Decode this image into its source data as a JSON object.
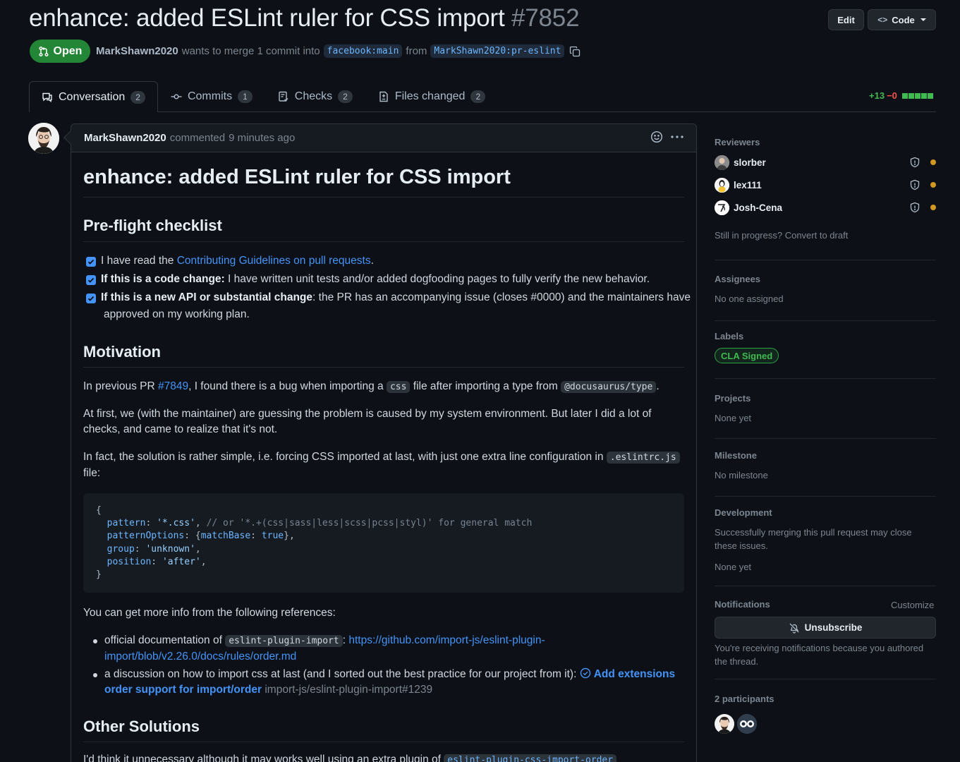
{
  "header": {
    "title": "enhance: added ESLint ruler for CSS import",
    "number": "#7852",
    "edit_label": "Edit",
    "code_label": "Code",
    "state": "Open",
    "author": "MarkShawn2020",
    "merge_text": "wants to merge 1 commit into",
    "base_branch": "facebook:main",
    "from_text": "from",
    "head_branch": "MarkShawn2020:pr-eslint"
  },
  "tabs": [
    {
      "label": "Conversation",
      "count": "2",
      "icon": "comment-icon"
    },
    {
      "label": "Commits",
      "count": "1",
      "icon": "commit-icon"
    },
    {
      "label": "Checks",
      "count": "2",
      "icon": "checklist-icon"
    },
    {
      "label": "Files changed",
      "count": "2",
      "icon": "file-diff-icon"
    }
  ],
  "diffstat": {
    "additions": "+13",
    "deletions": "−0"
  },
  "comment": {
    "author": "MarkShawn2020",
    "action": "commented",
    "time": "9 minutes ago",
    "title": "enhance: added ESLint ruler for CSS import",
    "checklist_heading": "Pre-flight checklist",
    "checklist": [
      {
        "pre": "I have read the ",
        "link": "Contributing Guidelines on pull requests",
        "post": "."
      },
      {
        "bold": "If this is a code change:",
        "text": " I have written unit tests and/or added dogfooding pages to fully verify the new behavior."
      },
      {
        "bold": "If this is a new API or substantial change",
        "text": ": the PR has an accompanying issue (closes #0000) and the maintainers have",
        "text2": "approved on my working plan."
      }
    ],
    "motivation_heading": "Motivation",
    "motivation_p1": {
      "pre": "In previous PR ",
      "link": "#7849",
      "mid": ", I found there is a bug when importing a ",
      "code1": "css",
      "mid2": " file after importing a type from ",
      "code2": "@docusaurus/type",
      "post": "."
    },
    "motivation_p2_line1": "At first, we (with the maintainer) are guessing the problem is caused by my system environment. But later I did a lot of",
    "motivation_p2_line2": "checks, and came to realize that it's not.",
    "motivation_p3": {
      "pre": "In fact, the solution is rather simple, i.e. forcing CSS imported at last, with just one extra line configuration in ",
      "code": ".eslintrc.js",
      "line2": "file:"
    },
    "code_lines": {
      "open": "{",
      "l1_key": "pattern",
      "l1_val": "'*.css'",
      "l1_comment": "// or '*.+(css|sass|less|scss|pcss|styl)' for general match",
      "l2_key": "patternOptions",
      "l2_inner_key": "matchBase",
      "l2_inner_val": "true",
      "l3_key": "group",
      "l3_val": "'unknown'",
      "l4_key": "position",
      "l4_val": "'after'",
      "close": "}"
    },
    "refs_intro": "You can get more info from the following references:",
    "ref1": {
      "pre": "official documentation of ",
      "code": "eslint-plugin-import",
      "mid": ": ",
      "link1": "https://github.com/import-js/eslint-plugin-",
      "link2": "import/blob/v2.26.0/docs/rules/order.md"
    },
    "ref2": {
      "pre": "a discussion on how to import css at last (and I sorted out the best practice for our project from it): ",
      "link1": "Add extensions",
      "link2": "order support for import/order",
      "repo": "import-js/eslint-plugin-import#1239"
    },
    "other_heading": "Other Solutions",
    "other_p": {
      "pre": "I'd think it unnecessary although it may works well using an extra plugin of ",
      "code": "eslint-plugin-css-import-order"
    }
  },
  "sidebar": {
    "reviewers_heading": "Reviewers",
    "reviewers": [
      "slorber",
      "lex111",
      "Josh-Cena"
    ],
    "draft_text": "Still in progress? Convert to draft",
    "assignees_heading": "Assignees",
    "assignees_value": "No one assigned",
    "labels_heading": "Labels",
    "label": "CLA Signed",
    "projects_heading": "Projects",
    "projects_value": "None yet",
    "milestone_heading": "Milestone",
    "milestone_value": "No milestone",
    "development_heading": "Development",
    "development_text1": "Successfully merging this pull request may close",
    "development_text2": "these issues.",
    "development_value": "None yet",
    "notifications_heading": "Notifications",
    "customize_label": "Customize",
    "unsubscribe_label": "Unsubscribe",
    "notif_text1": "You're receiving notifications because you authored",
    "notif_text2": "the thread.",
    "participants_heading": "2 participants"
  },
  "colors": {
    "accent": "#4493f8",
    "open_green": "#238636",
    "pending": "#d29922",
    "bg": "#0d1117"
  }
}
